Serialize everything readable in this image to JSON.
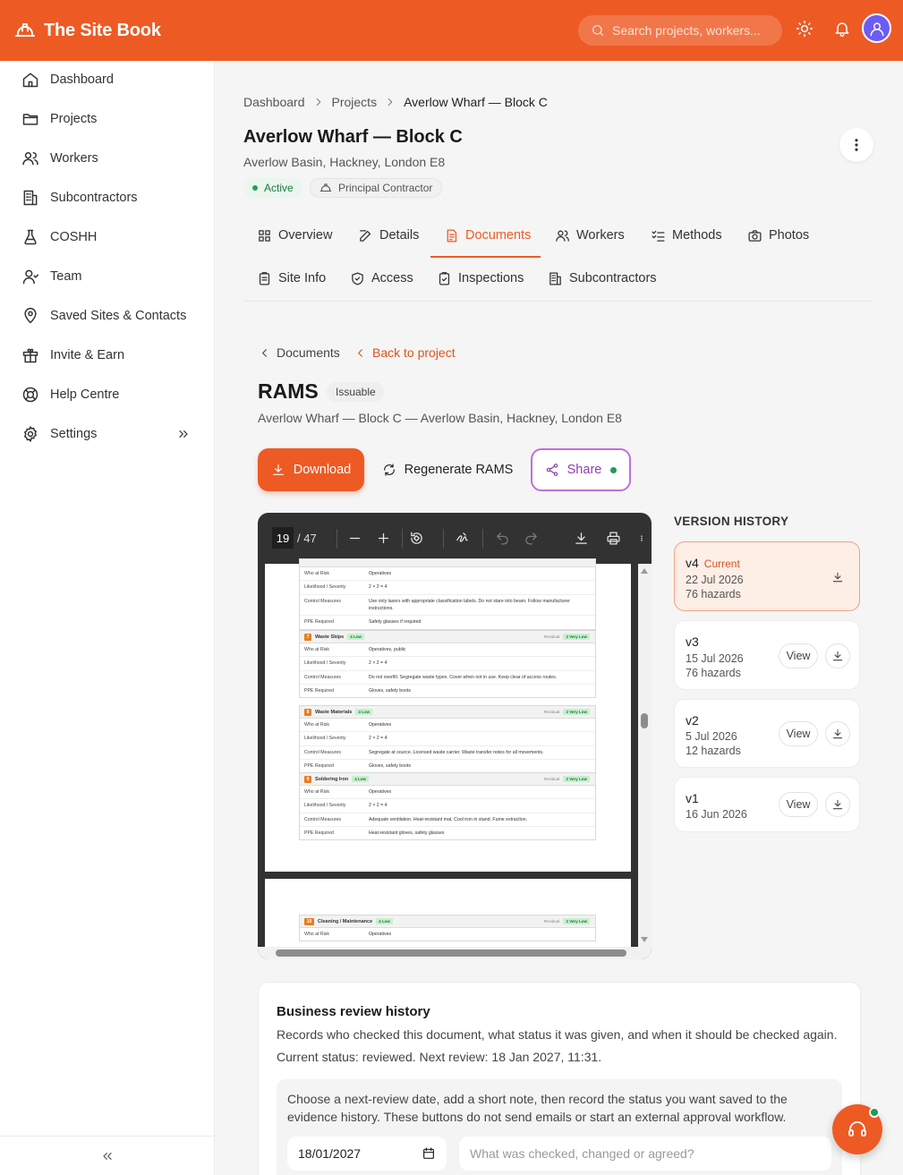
{
  "header": {
    "brand": "The Site Book",
    "search_placeholder": "Search projects, workers...",
    "icons": [
      "hard-hat-icon",
      "search-icon",
      "sun-icon",
      "bell-icon",
      "user-icon"
    ],
    "accent": "#ee5a24"
  },
  "sidebar": {
    "items": [
      {
        "label": "Dashboard",
        "icon": "home-icon"
      },
      {
        "label": "Projects",
        "icon": "folder-icon"
      },
      {
        "label": "Workers",
        "icon": "users-icon"
      },
      {
        "label": "Subcontractors",
        "icon": "building-icon"
      },
      {
        "label": "COSHH",
        "icon": "flask-icon"
      },
      {
        "label": "Team",
        "icon": "team-icon"
      },
      {
        "label": "Saved Sites & Contacts",
        "icon": "map-pin-icon"
      },
      {
        "label": "Invite & Earn",
        "icon": "gift-icon"
      },
      {
        "label": "Help Centre",
        "icon": "lifebuoy-icon"
      },
      {
        "label": "Settings",
        "icon": "gear-icon"
      }
    ],
    "collapse_icon": "double-chevron-left-icon"
  },
  "breadcrumb": [
    "Dashboard",
    "Projects",
    "Averlow Wharf — Block C"
  ],
  "project": {
    "title": "Averlow Wharf — Block C",
    "address": "Averlow Basin, Hackney, London E8",
    "status": "Active",
    "role": "Principal Contractor"
  },
  "tabs": {
    "row1": [
      "Overview",
      "Details",
      "Documents",
      "Workers",
      "Methods",
      "Photos"
    ],
    "row2": [
      "Site Info",
      "Access",
      "Inspections",
      "Subcontractors"
    ],
    "active": "Documents"
  },
  "subnav": {
    "documents": "Documents",
    "back": "Back to project"
  },
  "document": {
    "title": "RAMS",
    "badge": "Issuable",
    "subtitle": "Averlow Wharf — Block C — Averlow Basin, Hackney, London E8"
  },
  "actions": {
    "download": "Download",
    "regenerate": "Regenerate RAMS",
    "share": "Share"
  },
  "viewer": {
    "page": "19",
    "total": "/ 47",
    "hazards": [
      {
        "num": "",
        "name": "",
        "rating": "",
        "residual_label": "",
        "residual": "",
        "rows": [
          {
            "k": "Who at Risk",
            "v": "Operatives"
          },
          {
            "k": "Likelihood / Severity",
            "v": "2 × 2 = 4"
          },
          {
            "k": "Control Measures",
            "v": "Use only lasers with appropriate classification labels. Do not stare into beam. Follow manufacturer instructions."
          },
          {
            "k": "PPE Required",
            "v": "Safety glasses if required"
          }
        ]
      },
      {
        "num": "7",
        "name": "Waste Skips",
        "rating": "4 Low",
        "residual_label": "Residual:",
        "residual": "2 Very Low",
        "rows": [
          {
            "k": "Who at Risk",
            "v": "Operatives, public"
          },
          {
            "k": "Likelihood / Severity",
            "v": "2 × 2 = 4"
          },
          {
            "k": "Control Measures",
            "v": "Do not overfill. Segregate waste types. Cover when not in use. Keep clear of access routes."
          },
          {
            "k": "PPE Required",
            "v": "Gloves, safety boots"
          }
        ]
      },
      {
        "num": "8",
        "name": "Waste Materials",
        "rating": "4 Low",
        "residual_label": "Residual:",
        "residual": "2 Very Low",
        "rows": [
          {
            "k": "Who at Risk",
            "v": "Operatives"
          },
          {
            "k": "Likelihood / Severity",
            "v": "2 × 2 = 4"
          },
          {
            "k": "Control Measures",
            "v": "Segregate at source. Licensed waste carrier. Waste transfer notes for all movements."
          },
          {
            "k": "PPE Required",
            "v": "Gloves, safety boots"
          }
        ]
      },
      {
        "num": "9",
        "name": "Soldering Iron",
        "rating": "4 Low",
        "residual_label": "Residual:",
        "residual": "2 Very Low",
        "rows": [
          {
            "k": "Who at Risk",
            "v": "Operatives"
          },
          {
            "k": "Likelihood / Severity",
            "v": "2 × 2 = 4"
          },
          {
            "k": "Control Measures",
            "v": "Adequate ventilation. Heat-resistant mat. Cool iron in stand. Fume extraction."
          },
          {
            "k": "PPE Required",
            "v": "Heat-resistant gloves, safety glasses"
          }
        ]
      },
      {
        "num": "10",
        "name": "Cleaning / Maintenance",
        "rating": "4 Low",
        "residual_label": "Residual:",
        "residual": "2 Very Low",
        "rows": [
          {
            "k": "Who at Risk",
            "v": "Operatives"
          }
        ]
      }
    ]
  },
  "version_history": {
    "title": "VERSION HISTORY",
    "view_label": "View",
    "versions": [
      {
        "name": "v4",
        "current_label": "Current",
        "date": "22 Jul 2026",
        "hazards": "76 hazards"
      },
      {
        "name": "v3",
        "date": "15 Jul 2026",
        "hazards": "76 hazards"
      },
      {
        "name": "v2",
        "date": "5 Jul 2026",
        "hazards": "12 hazards"
      },
      {
        "name": "v1",
        "date": "16 Jun 2026"
      }
    ]
  },
  "review": {
    "title": "Business review history",
    "description": "Records who checked this document, what status it was given, and when it should be checked again.",
    "status": "Current status: reviewed. Next review: 18 Jan 2027, 11:31.",
    "hint": "Choose a next-review date, add a short note, then record the status you want saved to the evidence history. These buttons do not send emails or start an external approval workflow.",
    "date_value": "18/01/2027",
    "note_placeholder": "What was checked, changed or agreed?"
  },
  "support": {
    "icon": "headset-icon",
    "online_color": "#1f9d55"
  }
}
